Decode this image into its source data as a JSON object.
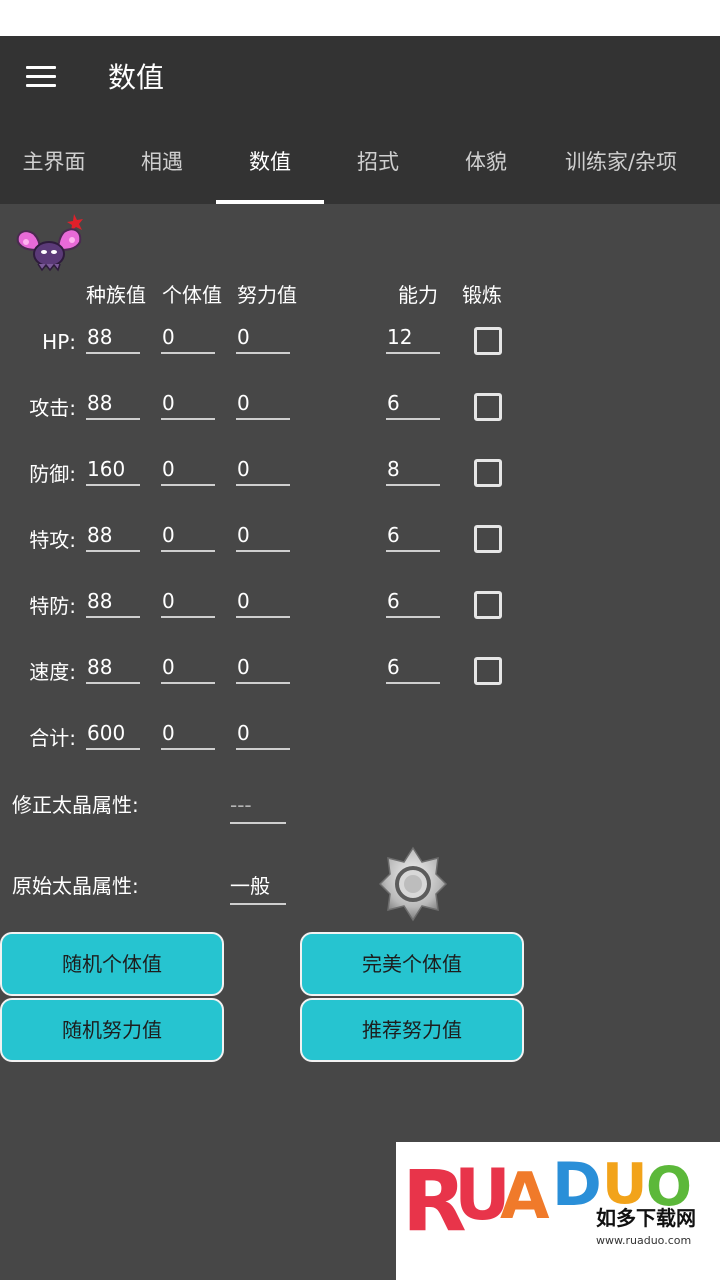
{
  "app": {
    "title": "数值"
  },
  "tabs": [
    {
      "label": "主界面"
    },
    {
      "label": "相遇"
    },
    {
      "label": "数值"
    },
    {
      "label": "招式"
    },
    {
      "label": "体貌"
    },
    {
      "label": "训练家/杂项"
    }
  ],
  "active_tab": "数值",
  "columns": {
    "base": "种族值",
    "iv": "个体值",
    "ev": "努力值",
    "stat": "能力",
    "train": "锻炼"
  },
  "stats": [
    {
      "label": "HP:",
      "base": "88",
      "iv": "0",
      "ev": "0",
      "stat": "12",
      "hyper_trained": false
    },
    {
      "label": "攻击:",
      "base": "88",
      "iv": "0",
      "ev": "0",
      "stat": "6",
      "hyper_trained": false
    },
    {
      "label": "防御:",
      "base": "160",
      "iv": "0",
      "ev": "0",
      "stat": "8",
      "hyper_trained": false
    },
    {
      "label": "特攻:",
      "base": "88",
      "iv": "0",
      "ev": "0",
      "stat": "6",
      "hyper_trained": false
    },
    {
      "label": "特防:",
      "base": "88",
      "iv": "0",
      "ev": "0",
      "stat": "6",
      "hyper_trained": false
    },
    {
      "label": "速度:",
      "base": "88",
      "iv": "0",
      "ev": "0",
      "stat": "6",
      "hyper_trained": false
    }
  ],
  "total": {
    "label": "合计:",
    "base": "600",
    "iv": "0",
    "ev": "0"
  },
  "tera": {
    "modified_label": "修正太晶属性:",
    "modified_value": "---",
    "original_label": "原始太晶属性:",
    "original_value": "一般"
  },
  "buttons": {
    "random_iv": "随机个体值",
    "perfect_iv": "完美个体值",
    "random_ev": "随机努力值",
    "suggest_ev": "推荐努力值"
  },
  "watermark": {
    "logo_letters": [
      "R",
      "U",
      "A",
      "D",
      "U",
      "O"
    ],
    "cn": "如多下载网",
    "url": "www.ruaduo.com"
  },
  "colors": {
    "background": "#474747",
    "appbar": "#333333",
    "button": "#26c4d0",
    "sprite_pink": "#e86ad8"
  },
  "icons": {
    "menu": "menu-icon",
    "sprite": "pokemon-sprite-icon",
    "tera": "tera-type-normal-icon"
  }
}
